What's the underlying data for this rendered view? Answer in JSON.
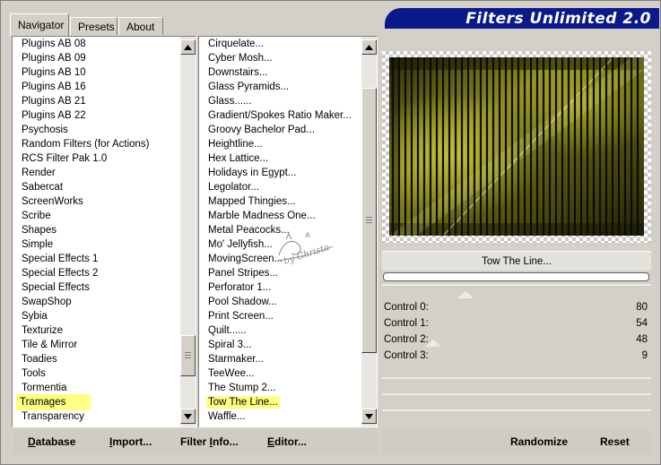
{
  "tabs": [
    {
      "label": "Navigator"
    },
    {
      "label": "Presets"
    },
    {
      "label": "About"
    }
  ],
  "banner": {
    "title": "Filters Unlimited 2.0"
  },
  "categories": {
    "items": [
      "Plugins AB 08",
      "Plugins AB 09",
      "Plugins AB 10",
      "Plugins AB 16",
      "Plugins AB 21",
      "Plugins AB 22",
      "Psychosis",
      "Random Filters (for Actions)",
      "RCS Filter Pak 1.0",
      "Render",
      "Sabercat",
      "ScreenWorks",
      "Scribe",
      "Shapes",
      "Simple",
      "Special Effects 1",
      "Special Effects 2",
      "Special Effects",
      "SwapShop",
      "Sybia",
      "Texturize",
      "Tile & Mirror",
      "Toadies",
      "Tools",
      "Tormentia",
      "Tramages",
      "Transparency"
    ],
    "selected": "Tramages"
  },
  "filters": {
    "items": [
      "Cirquelate...",
      "Cyber Mosh...",
      "Downstairs...",
      "Glass Pyramids...",
      "Glass......",
      "Gradient/Spokes Ratio Maker...",
      "Groovy Bachelor Pad...",
      "Heightline...",
      "Hex Lattice...",
      "Holidays in Egypt...",
      "Legolator...",
      "Mapped Thingies...",
      "Marble Madness One...",
      "Metal Peacocks...",
      "Mo' Jellyfish...",
      "MovingScreen...",
      "Panel Stripes...",
      "Perforator 1...",
      "Pool Shadow...",
      "Print Screen...",
      "Quilt......",
      "Spiral 3...",
      "Starmaker...",
      "TeeWee...",
      "The Stump 2...",
      "Tow The Line...",
      "Waffle..."
    ],
    "selected": "Tow The Line..."
  },
  "preview": {
    "filter_name": "Tow The Line...",
    "watermark": "by Ghrista"
  },
  "controls": [
    {
      "label": "Control 0:",
      "value": "80"
    },
    {
      "label": "Control 1:",
      "value": "54"
    },
    {
      "label": "Control 2:",
      "value": "48"
    },
    {
      "label": "Control 3:",
      "value": "9"
    }
  ],
  "buttons": {
    "database": {
      "u": "D",
      "rest": "atabase"
    },
    "import": {
      "u": "I",
      "rest": "mport..."
    },
    "filter_info": {
      "pre": "Filter ",
      "u": "I",
      "rest": "nfo..."
    },
    "editor": {
      "u": "E",
      "rest": "ditor..."
    },
    "randomize": "Randomize",
    "reset": "Reset"
  },
  "colors": {
    "banner": "#0a1a8a",
    "selection": "#ffff80",
    "preview_tint": "#9a9a1c"
  }
}
